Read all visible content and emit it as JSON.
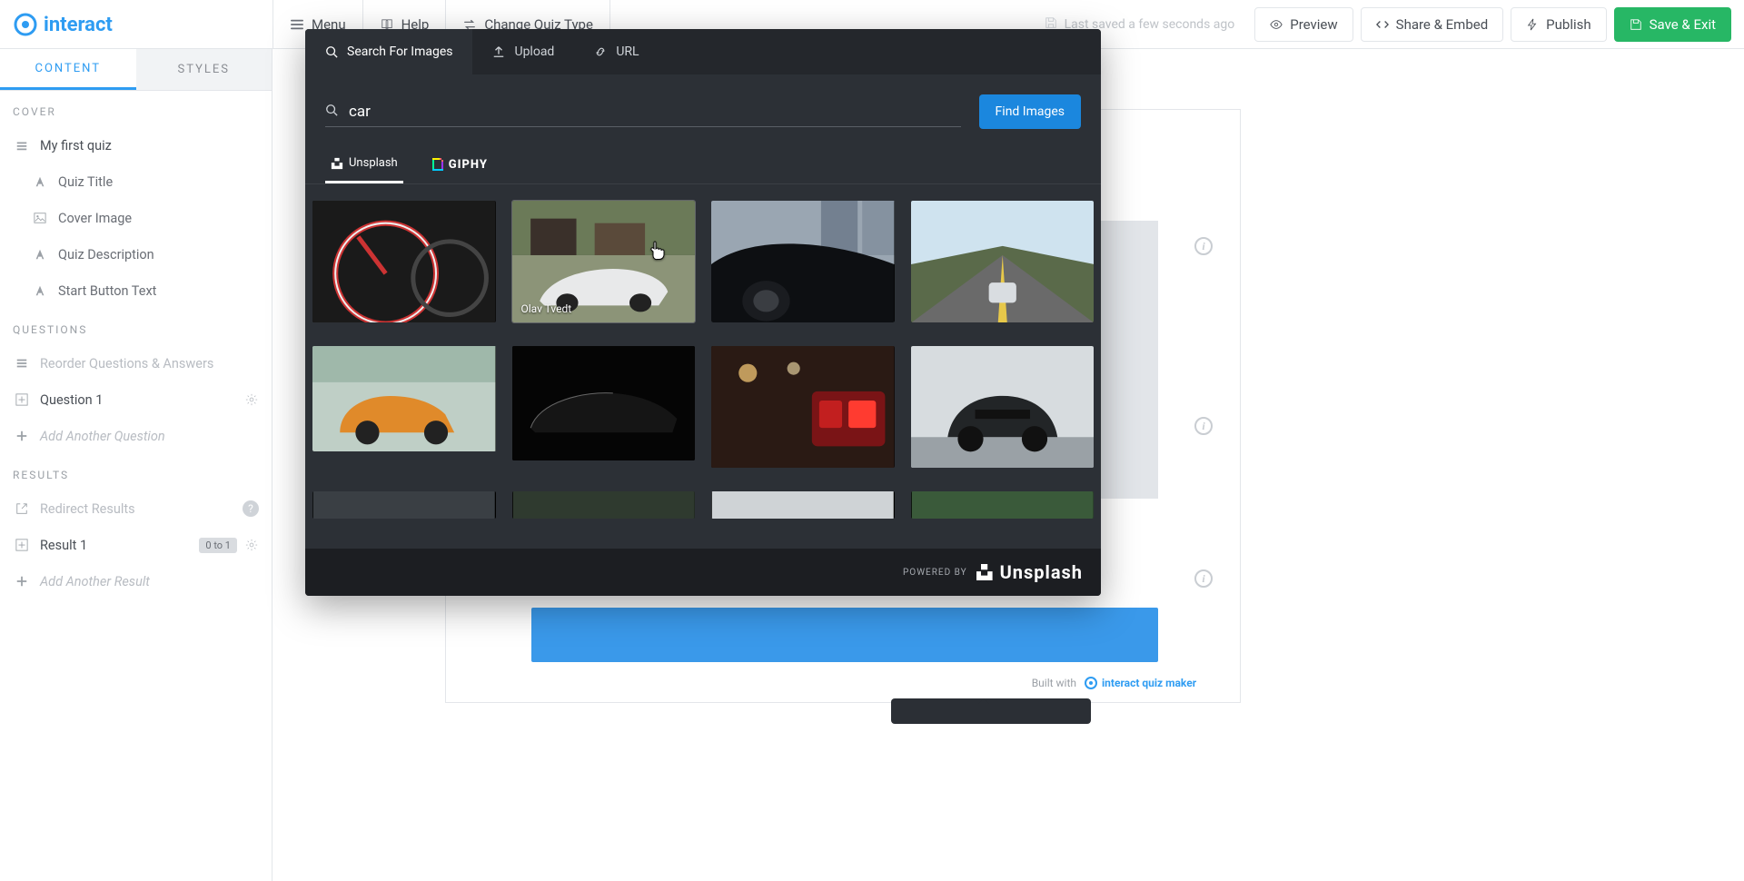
{
  "topbar": {
    "menu": "Menu",
    "help": "Help",
    "change_type": "Change Quiz Type",
    "autosave": "Last saved a few seconds ago",
    "preview": "Preview",
    "share_embed": "Share & Embed",
    "publish": "Publish",
    "save_exit": "Save & Exit"
  },
  "sidebar": {
    "tab_content": "CONTENT",
    "tab_styles": "STYLES",
    "cover_hdr": "COVER",
    "cover_items": {
      "quiz_name": "My first quiz",
      "quiz_title": "Quiz Title",
      "cover_image": "Cover Image",
      "quiz_description": "Quiz Description",
      "start_button_text": "Start Button Text"
    },
    "questions_hdr": "QUESTIONS",
    "reorder_qa": "Reorder Questions & Answers",
    "question1": "Question 1",
    "add_question": "Add Another Question",
    "results_hdr": "RESULTS",
    "redirect_results": "Redirect Results",
    "result1": "Result 1",
    "result1_badge": "0 to 1",
    "add_result": "Add Another Result"
  },
  "canvas": {
    "built_with": "Built with",
    "brand_text": "interact quiz maker"
  },
  "modal": {
    "tab_search": "Search For Images",
    "tab_upload": "Upload",
    "tab_url": "URL",
    "search_value": "car",
    "find_images": "Find Images",
    "provider_unsplash": "Unsplash",
    "provider_giphy": "GIPHY",
    "credit_row1_col2": "Olav Tvedt",
    "footer_powered": "POWERED BY",
    "footer_brand": "Unsplash"
  },
  "icons": {
    "menu": "menu-icon",
    "help": "book-icon",
    "swap": "swap-icon",
    "floppy": "floppy-icon",
    "eye": "eye-icon",
    "code": "code-icon",
    "bolt": "bolt-icon",
    "save": "save-icon"
  },
  "colors": {
    "brand_blue": "#2e9cf2",
    "brand_green": "#27b765",
    "modal_bg": "#2c3036"
  }
}
